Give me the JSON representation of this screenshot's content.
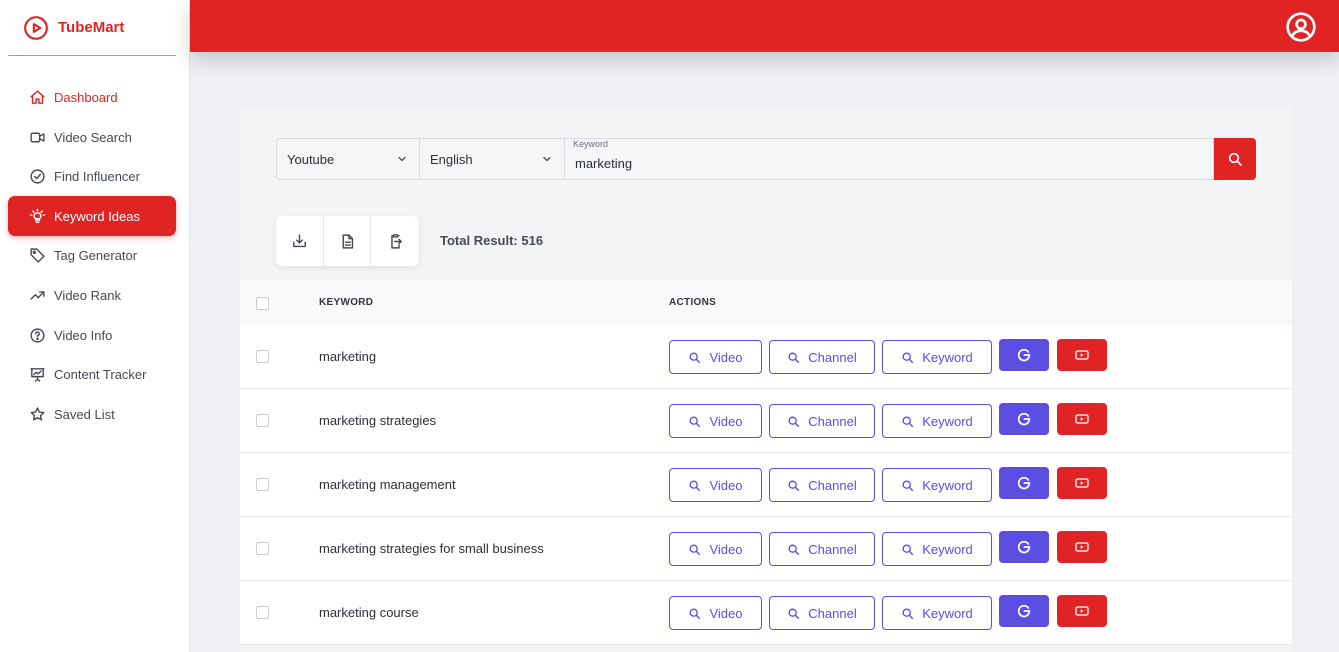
{
  "brand": {
    "name": "TubeMart",
    "icon": "play-circle-icon"
  },
  "sidebar": {
    "items": [
      {
        "label": "Dashboard",
        "icon": "home-icon"
      },
      {
        "label": "Video Search",
        "icon": "video-camera-icon"
      },
      {
        "label": "Find Influencer",
        "icon": "check-circle-icon"
      },
      {
        "label": "Keyword Ideas",
        "icon": "lightbulb-icon"
      },
      {
        "label": "Tag Generator",
        "icon": "tag-icon"
      },
      {
        "label": "Video Rank",
        "icon": "trending-up-icon"
      },
      {
        "label": "Video Info",
        "icon": "question-circle-icon"
      },
      {
        "label": "Content Tracker",
        "icon": "presentation-chart-icon"
      },
      {
        "label": "Saved List",
        "icon": "star-icon"
      }
    ],
    "active_index": 3
  },
  "header": {
    "profile_icon": "user-circle-icon"
  },
  "search": {
    "platform": "Youtube",
    "language": "English",
    "keyword_label": "Keyword",
    "keyword_value": "marketing",
    "button_icon": "search-icon"
  },
  "toolbar": {
    "icons": [
      "download-icon",
      "document-icon",
      "clipboard-copy-icon"
    ],
    "total_label": "Total Result: 516"
  },
  "table": {
    "columns": {
      "keyword": "KEYWORD",
      "actions": "ACTIONS"
    },
    "action_labels": {
      "video": "Video",
      "channel": "Channel",
      "keyword": "Keyword"
    },
    "rows": [
      {
        "keyword": "marketing"
      },
      {
        "keyword": "marketing strategies"
      },
      {
        "keyword": "marketing management"
      },
      {
        "keyword": "marketing strategies for small business"
      },
      {
        "keyword": "marketing course"
      }
    ]
  },
  "colors": {
    "accent": "#e02424",
    "action": "#5b4ee0"
  }
}
